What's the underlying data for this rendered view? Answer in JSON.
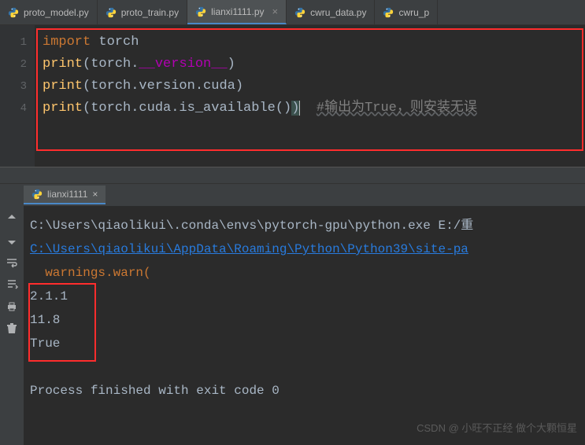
{
  "tabs": [
    {
      "label": "proto_model.py",
      "active": false
    },
    {
      "label": "proto_train.py",
      "active": false
    },
    {
      "label": "lianxi1111.py",
      "active": true
    },
    {
      "label": "cwru_data.py",
      "active": false
    },
    {
      "label": "cwru_p",
      "active": false
    }
  ],
  "lineNumbers": [
    "1",
    "2",
    "3",
    "4"
  ],
  "code": {
    "l1": {
      "kw1": "import ",
      "id": "torch"
    },
    "l2": {
      "fn": "print",
      "p1": "(",
      "obj": "torch.",
      "dunder": "__version__",
      "p2": ")"
    },
    "l3": {
      "fn": "print",
      "p1": "(",
      "obj": "torch.version.cuda",
      "p2": ")"
    },
    "l4": {
      "fn": "print",
      "p1": "(",
      "obj": "torch.cuda.is_available()",
      "p2": ")",
      "cursor": " ",
      "comment": "#输出为True，则安装无误"
    }
  },
  "runTab": {
    "label": "lianxi1111"
  },
  "console": {
    "cmd": "C:\\Users\\qiaolikui\\.conda\\envs\\pytorch-gpu\\python.exe E:/重",
    "link": "C:\\Users\\qiaolikui\\AppData\\Roaming\\Python\\Python39\\site-pa",
    "warn": "  warnings.warn(",
    "out1": "2.1.1",
    "out2": "11.8",
    "out3": "True",
    "exit": "Process finished with exit code 0"
  },
  "watermark": "CSDN @ 小旺不正经 做个大颗恒星"
}
